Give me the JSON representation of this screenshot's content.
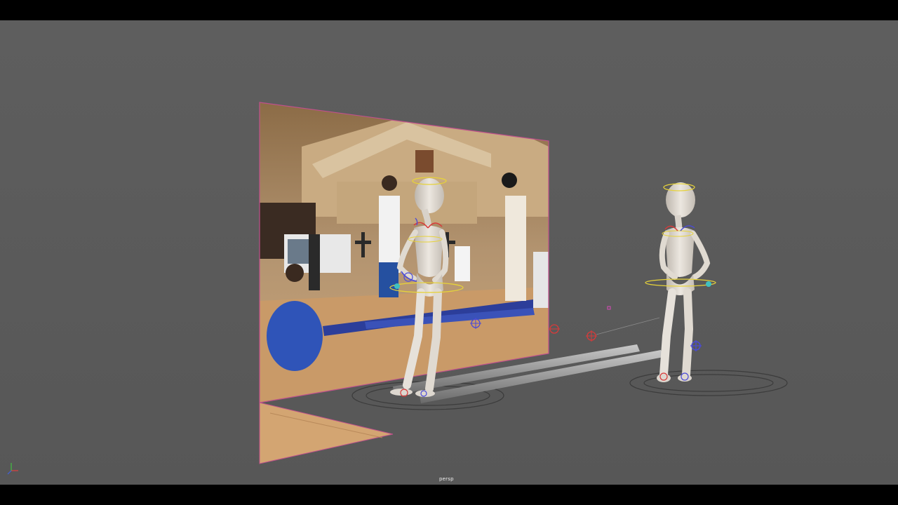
{
  "viewport": {
    "camera_label": "persp",
    "background_color": "#5c5c5c"
  },
  "scene": {
    "image_plane": {
      "description_icon": "reference-video-frame",
      "border_color": "#c0508c"
    },
    "rigs": [
      {
        "name": "character-rig",
        "icon": "biped-figure"
      },
      {
        "name": "character-rig",
        "icon": "biped-figure"
      }
    ],
    "props": [
      {
        "name": "bamboo-pole",
        "icon": "cylinder"
      },
      {
        "name": "bamboo-pole",
        "icon": "cylinder"
      }
    ]
  },
  "axis_indicator": {
    "icon": "xyz-axis-icon",
    "colors": {
      "x": "#e04040",
      "y": "#40c040",
      "z": "#4060e0"
    }
  }
}
